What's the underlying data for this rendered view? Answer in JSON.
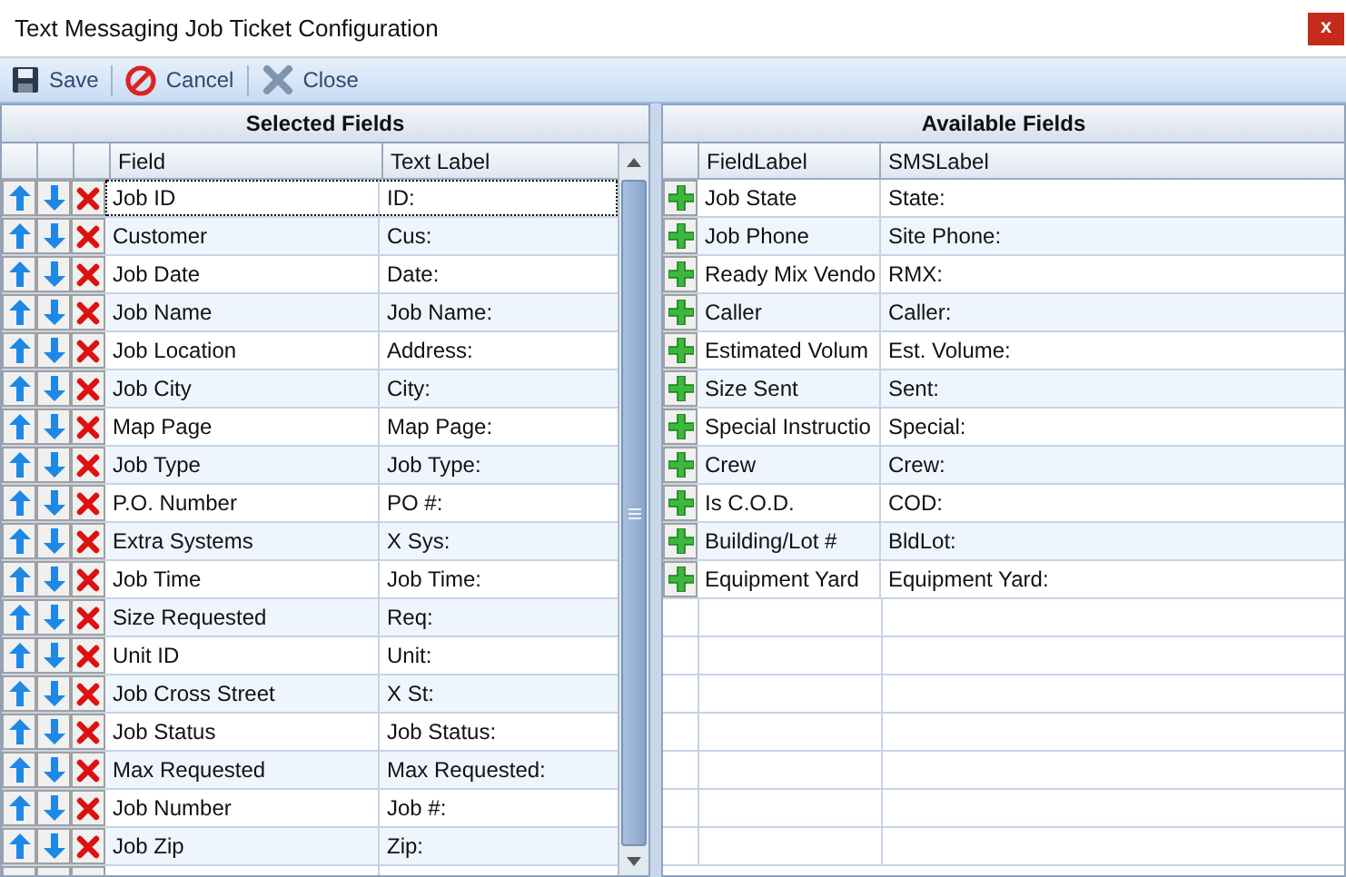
{
  "window": {
    "title": "Text Messaging Job Ticket Configuration",
    "close": "x"
  },
  "toolbar": [
    {
      "kind": "save",
      "label": "Save"
    },
    {
      "kind": "cancel",
      "label": "Cancel"
    },
    {
      "kind": "close",
      "label": "Close"
    }
  ],
  "selected_fields": {
    "title": "Selected Fields",
    "columns": [
      "Field",
      "Text Label"
    ],
    "rows": [
      {
        "field": "Job ID",
        "text_label": "ID:",
        "selected": true
      },
      {
        "field": "Customer",
        "text_label": "Cus:",
        "selected": false
      },
      {
        "field": "Job Date",
        "text_label": "Date:",
        "selected": false
      },
      {
        "field": "Job Name",
        "text_label": "Job Name:",
        "selected": false
      },
      {
        "field": "Job Location",
        "text_label": "Address:",
        "selected": false
      },
      {
        "field": "Job City",
        "text_label": "City:",
        "selected": false
      },
      {
        "field": "Map Page",
        "text_label": "Map Page:",
        "selected": false
      },
      {
        "field": "Job Type",
        "text_label": "Job Type:",
        "selected": false
      },
      {
        "field": "P.O. Number",
        "text_label": "PO #:",
        "selected": false
      },
      {
        "field": "Extra Systems",
        "text_label": "X Sys:",
        "selected": false
      },
      {
        "field": "Job Time",
        "text_label": "Job Time:",
        "selected": false
      },
      {
        "field": "Size Requested",
        "text_label": "Req:",
        "selected": false
      },
      {
        "field": "Unit ID",
        "text_label": "Unit:",
        "selected": false
      },
      {
        "field": "Job Cross Street",
        "text_label": "X St:",
        "selected": false
      },
      {
        "field": "Job Status",
        "text_label": "Job Status:",
        "selected": false
      },
      {
        "field": "Max Requested",
        "text_label": "Max Requested:",
        "selected": false
      },
      {
        "field": "Job Number",
        "text_label": "Job #:",
        "selected": false
      },
      {
        "field": "Job Zip",
        "text_label": "Zip:",
        "selected": false
      }
    ]
  },
  "available_fields": {
    "title": "Available Fields",
    "columns": [
      "FieldLabel",
      "SMSLabel"
    ],
    "rows": [
      {
        "field_label": "Job State",
        "sms_label": "State:"
      },
      {
        "field_label": "Job Phone",
        "sms_label": "Site Phone:"
      },
      {
        "field_label": "Ready Mix Vendo",
        "sms_label": "RMX:"
      },
      {
        "field_label": "Caller",
        "sms_label": "Caller:"
      },
      {
        "field_label": "Estimated Volum",
        "sms_label": "Est. Volume:"
      },
      {
        "field_label": "Size Sent",
        "sms_label": "Sent:"
      },
      {
        "field_label": "Special Instructio",
        "sms_label": "Special:"
      },
      {
        "field_label": "Crew",
        "sms_label": "Crew:"
      },
      {
        "field_label": "Is C.O.D.",
        "sms_label": "COD:"
      },
      {
        "field_label": "Building/Lot #",
        "sms_label": "BldLot:"
      },
      {
        "field_label": "Equipment Yard",
        "sms_label": "Equipment Yard:"
      }
    ]
  }
}
